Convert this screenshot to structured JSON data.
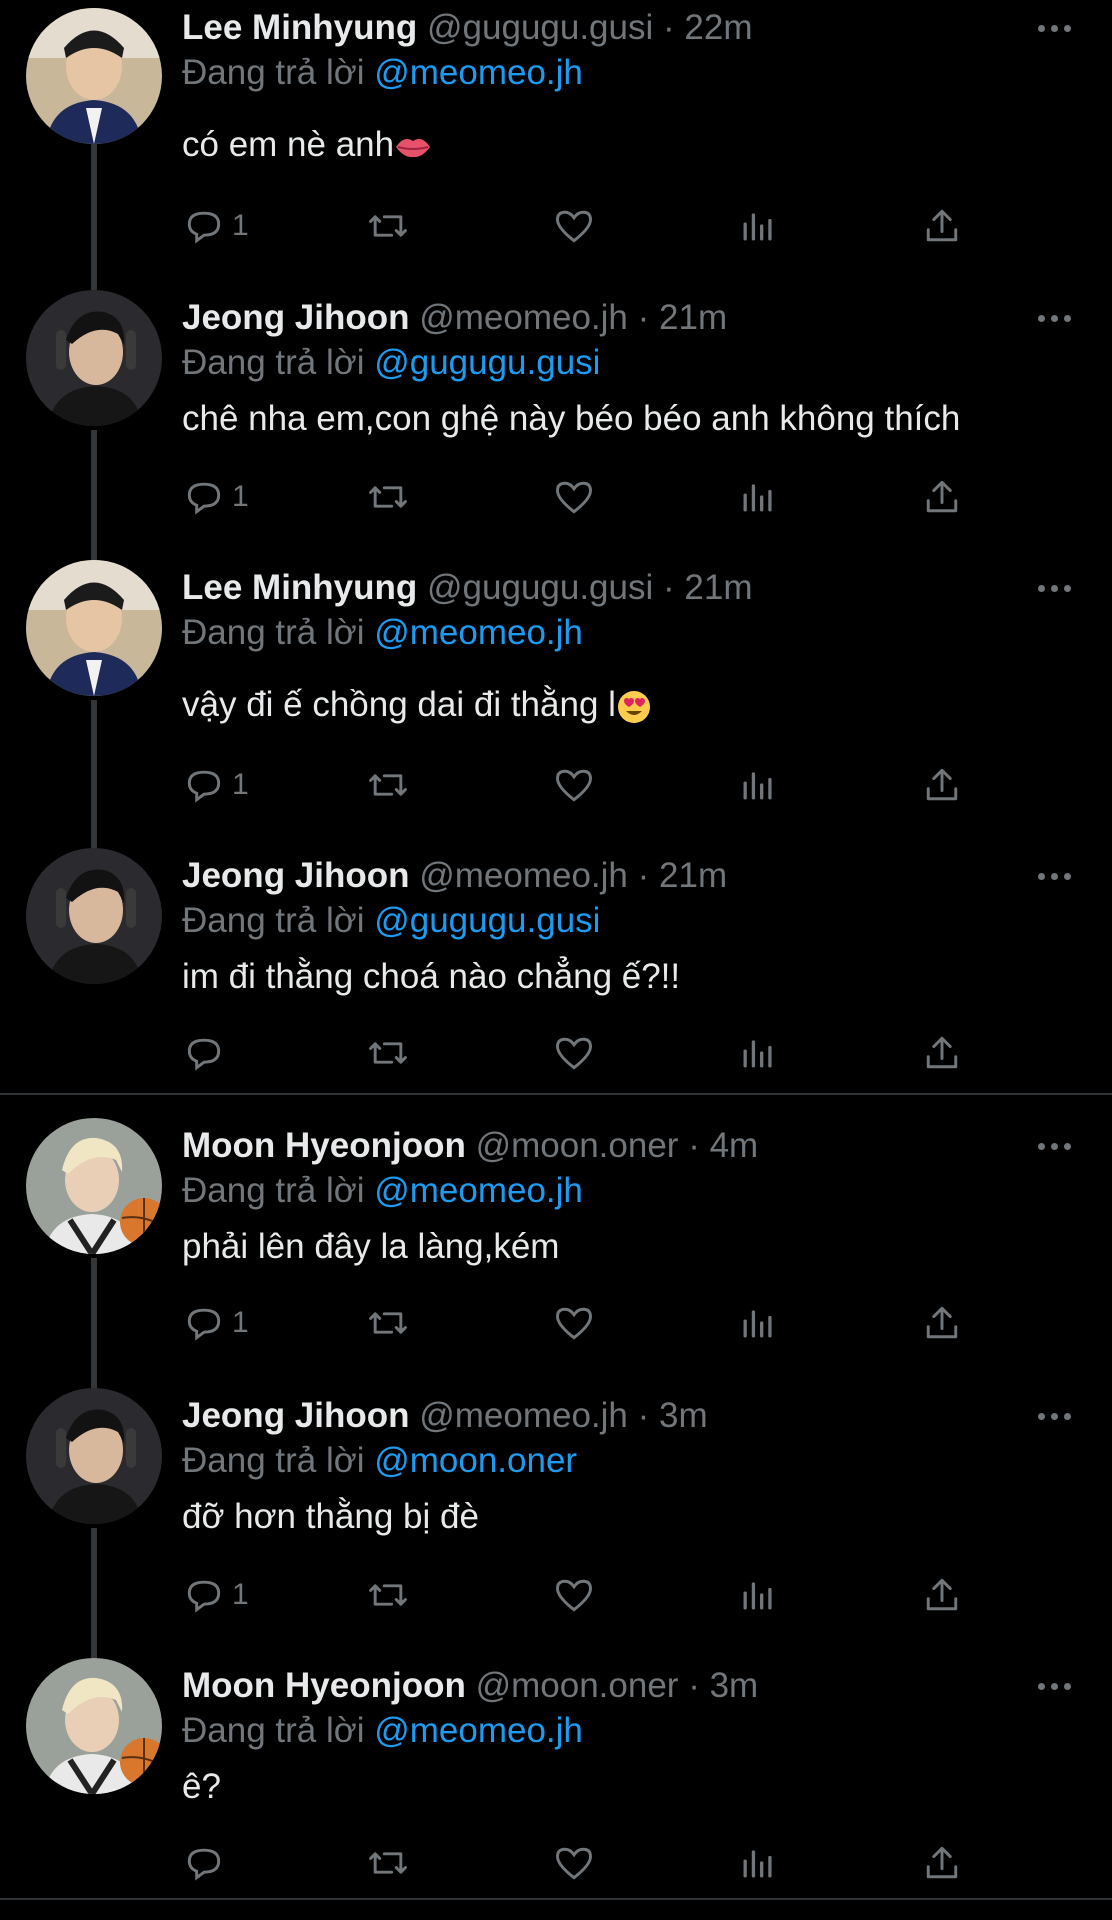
{
  "tweets": [
    {
      "name": "Lee Minhyung",
      "handle": "@gugugu.gusi",
      "sep": "·",
      "time": "22m",
      "reply_prefix": "Đang trả lời",
      "reply_to": "@meomeo.jh",
      "text": "có em nè anh",
      "emoji": "lips",
      "reply_count": "1",
      "avatar": "minhyung-avatar"
    },
    {
      "name": "Jeong Jihoon",
      "handle": "@meomeo.jh",
      "sep": "·",
      "time": "21m",
      "reply_prefix": "Đang trả lời",
      "reply_to": "@gugugu.gusi",
      "text": "chê nha em,con ghệ này béo béo anh không thích",
      "emoji": "",
      "reply_count": "1",
      "avatar": "jihoon-avatar"
    },
    {
      "name": "Lee Minhyung",
      "handle": "@gugugu.gusi",
      "sep": "·",
      "time": "21m",
      "reply_prefix": "Đang trả lời",
      "reply_to": "@meomeo.jh",
      "text": "vậy đi ế chồng dai đi thằng l",
      "emoji": "heart-eyes",
      "reply_count": "1",
      "avatar": "minhyung-avatar"
    },
    {
      "name": "Jeong Jihoon",
      "handle": "@meomeo.jh",
      "sep": "·",
      "time": "21m",
      "reply_prefix": "Đang trả lời",
      "reply_to": "@gugugu.gusi",
      "text": "im đi thằng choá nào chẳng ế?!!",
      "emoji": "",
      "reply_count": "",
      "avatar": "jihoon-avatar"
    },
    {
      "name": "Moon Hyeonjoon",
      "handle": "@moon.oner",
      "sep": "·",
      "time": "4m",
      "reply_prefix": "Đang trả lời",
      "reply_to": "@meomeo.jh",
      "text": "phải lên đây la làng,kém",
      "emoji": "",
      "reply_count": "1",
      "avatar": "hyeonjoon-avatar"
    },
    {
      "name": "Jeong Jihoon",
      "handle": "@meomeo.jh",
      "sep": "·",
      "time": "3m",
      "reply_prefix": "Đang trả lời",
      "reply_to": "@moon.oner",
      "text": "đỡ hơn thằng bị đè",
      "emoji": "",
      "reply_count": "1",
      "avatar": "jihoon-avatar"
    },
    {
      "name": "Moon Hyeonjoon",
      "handle": "@moon.oner",
      "sep": "·",
      "time": "3m",
      "reply_prefix": "Đang trả lời",
      "reply_to": "@meomeo.jh",
      "text": "ê?",
      "emoji": "",
      "reply_count": "",
      "avatar": "hyeonjoon-avatar"
    }
  ],
  "colors": {
    "background": "#000000",
    "text": "#e7e9ea",
    "muted": "#71767b",
    "link": "#1d9bf0",
    "divider": "#2f3336"
  },
  "icons": [
    "reply-icon",
    "retweet-icon",
    "like-icon",
    "views-icon",
    "share-icon",
    "more-icon"
  ]
}
